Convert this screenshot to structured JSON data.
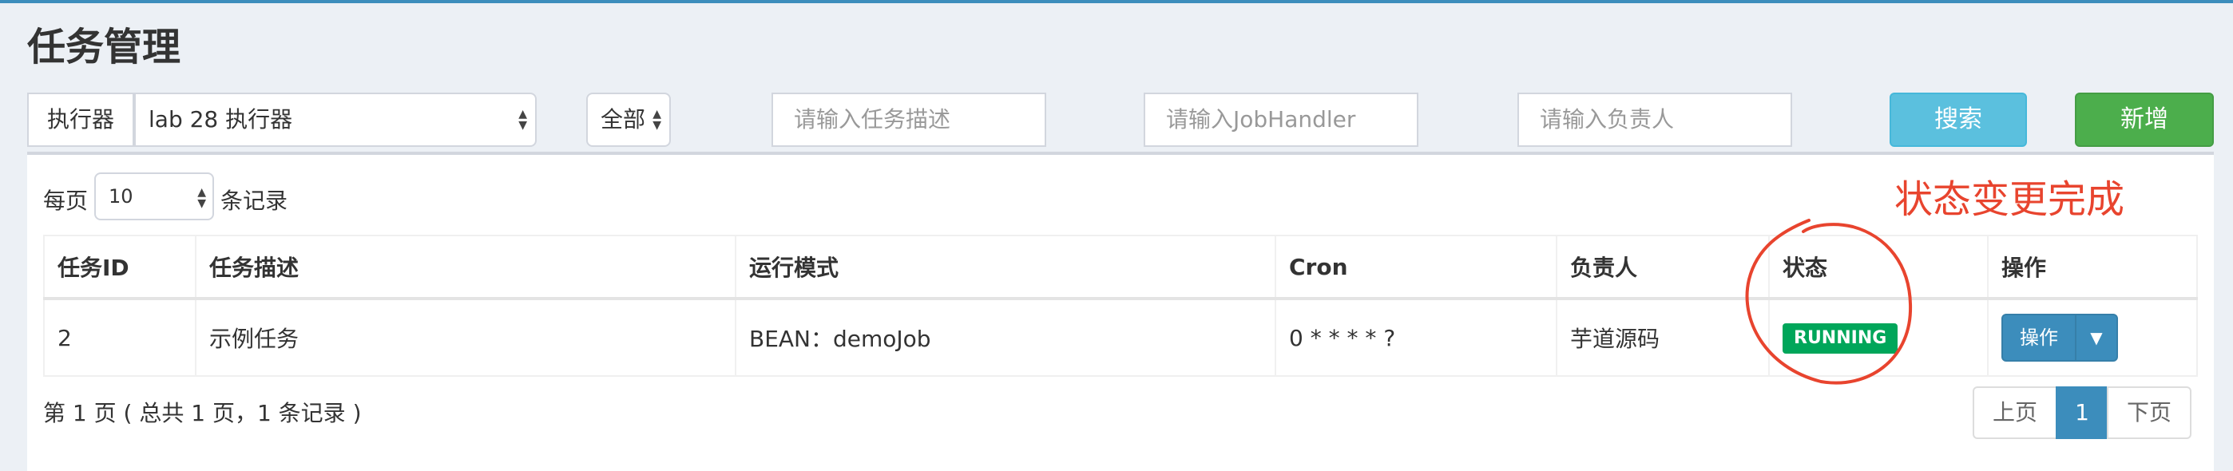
{
  "page": {
    "title": "任务管理"
  },
  "filters": {
    "executor_label": "执行器",
    "executor_value": "lab 28 执行器",
    "status_value": "全部",
    "desc_placeholder": "请输入任务描述",
    "handler_placeholder": "请输入JobHandler",
    "owner_placeholder": "请输入负责人",
    "search_label": "搜索",
    "add_label": "新增"
  },
  "list": {
    "per_page_prefix": "每页",
    "per_page_value": "10",
    "per_page_suffix": "条记录",
    "columns": [
      "任务ID",
      "任务描述",
      "运行模式",
      "Cron",
      "负责人",
      "状态",
      "操作"
    ],
    "rows": [
      {
        "id": "2",
        "desc": "示例任务",
        "mode": "BEAN：demoJob",
        "cron": "0 * * * * ?",
        "owner": "芋道源码",
        "status": "RUNNING",
        "action": "操作"
      }
    ],
    "page_info": "第 1 页 ( 总共 1 页，1 条记录 )",
    "pager": {
      "prev": "上页",
      "current": "1",
      "next": "下页"
    }
  },
  "annotation": {
    "text": "状态变更完成",
    "color": "#e8442e"
  },
  "colors": {
    "primary": "#3c8dbc",
    "info": "#5bc0de",
    "success": "#4cae4c",
    "badge": "#00a65a"
  }
}
